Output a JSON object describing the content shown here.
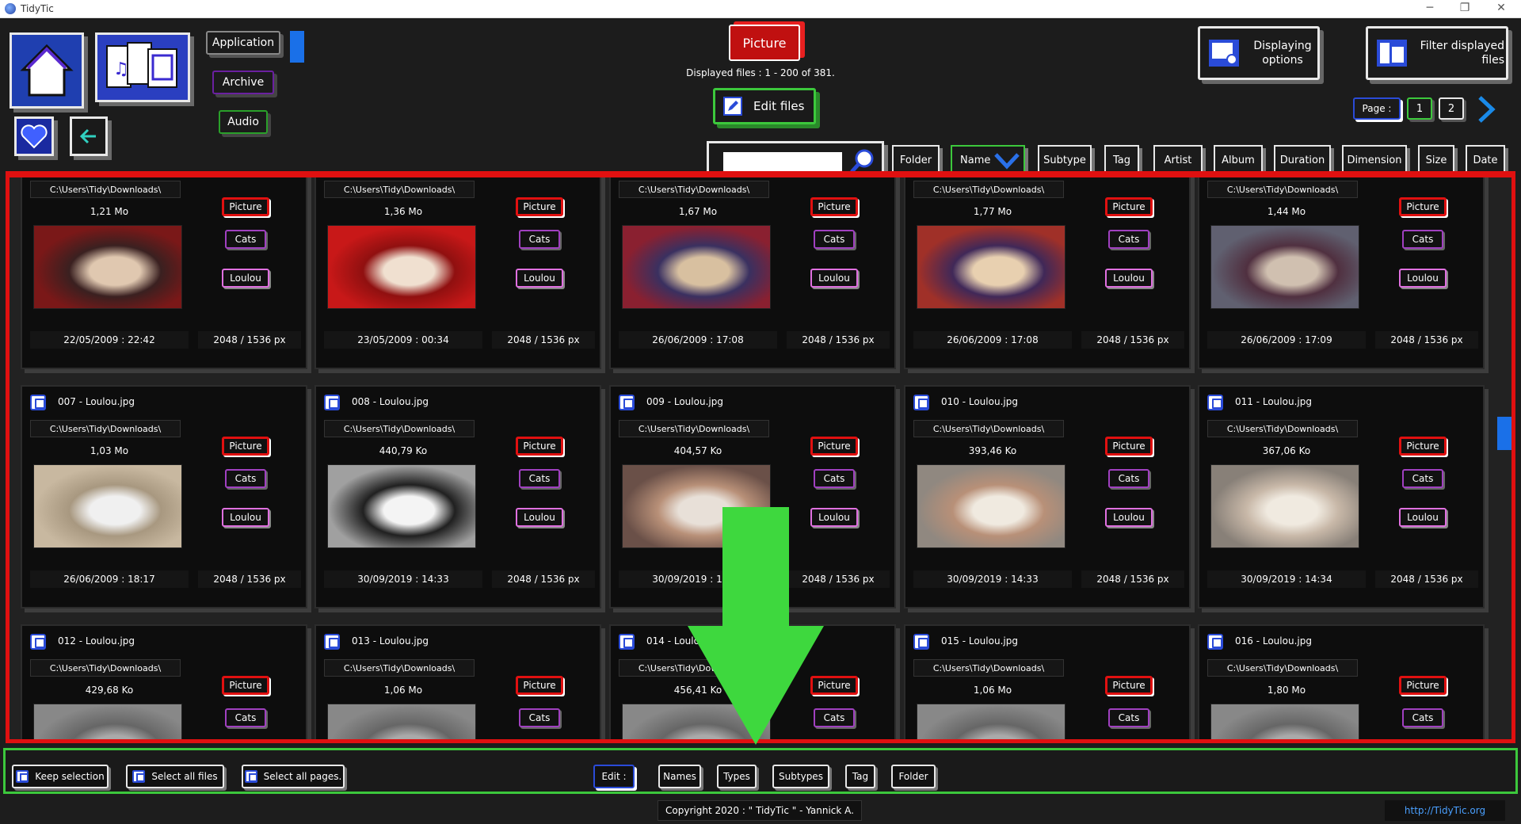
{
  "window": {
    "title": "TidyTic"
  },
  "header": {
    "category_buttons": [
      "Application",
      "Archive",
      "Audio"
    ],
    "type_badge": "Picture",
    "displayed_info": "Displayed files : 1 - 200 of 381.",
    "edit_files_label": "Edit files",
    "displaying_options_label": "Displaying options",
    "filter_label": "Filter displayed files",
    "page_label": "Page :",
    "pages": [
      "1",
      "2"
    ],
    "search_value": ""
  },
  "sort_columns": [
    "Folder",
    "Name",
    "Subtype",
    "Tag",
    "Artist",
    "Album",
    "Duration",
    "Dimension",
    "Size",
    "Date"
  ],
  "cards": [
    {
      "name": "",
      "path": "C:\\Users\\Tidy\\Downloads\\",
      "size": "1,21 Mo",
      "date": "22/05/2009 : 22:42",
      "dim": "2048 / 1536 px",
      "type": "Picture",
      "subtype": "Cats",
      "tag": "Loulou",
      "colors": [
        "#7a1818",
        "#e0c8b0",
        "#3a2020"
      ]
    },
    {
      "name": "",
      "path": "C:\\Users\\Tidy\\Downloads\\",
      "size": "1,36 Mo",
      "date": "23/05/2009 : 00:34",
      "dim": "2048 / 1536 px",
      "type": "Picture",
      "subtype": "Cats",
      "tag": "Loulou",
      "colors": [
        "#c81818",
        "#f0e0d0",
        "#901010"
      ]
    },
    {
      "name": "",
      "path": "C:\\Users\\Tidy\\Downloads\\",
      "size": "1,67 Mo",
      "date": "26/06/2009 : 17:08",
      "dim": "2048 / 1536 px",
      "type": "Picture",
      "subtype": "Cats",
      "tag": "Loulou",
      "colors": [
        "#8a2030",
        "#d8c0a0",
        "#3a3060"
      ]
    },
    {
      "name": "",
      "path": "C:\\Users\\Tidy\\Downloads\\",
      "size": "1,77 Mo",
      "date": "26/06/2009 : 17:08",
      "dim": "2048 / 1536 px",
      "type": "Picture",
      "subtype": "Cats",
      "tag": "Loulou",
      "colors": [
        "#a03028",
        "#e8d0b0",
        "#402858"
      ]
    },
    {
      "name": "",
      "path": "C:\\Users\\Tidy\\Downloads\\",
      "size": "1,44 Mo",
      "date": "26/06/2009 : 17:09",
      "dim": "2048 / 1536 px",
      "type": "Picture",
      "subtype": "Cats",
      "tag": "Loulou",
      "colors": [
        "#606070",
        "#d0c0b0",
        "#503040"
      ]
    },
    {
      "name": "007 - Loulou.jpg",
      "path": "C:\\Users\\Tidy\\Downloads\\",
      "size": "1,03 Mo",
      "date": "26/06/2009 : 18:17",
      "dim": "2048 / 1536 px",
      "type": "Picture",
      "subtype": "Cats",
      "tag": "Loulou",
      "colors": [
        "#c8b8a0",
        "#f0f0f0",
        "#a89880"
      ]
    },
    {
      "name": "008 - Loulou.jpg",
      "path": "C:\\Users\\Tidy\\Downloads\\",
      "size": "440,79 Ko",
      "date": "30/09/2019 : 14:33",
      "dim": "2048 / 1536 px",
      "type": "Picture",
      "subtype": "Cats",
      "tag": "Loulou",
      "colors": [
        "#a0a0a0",
        "#f4f4f4",
        "#202020"
      ]
    },
    {
      "name": "009 - Loulou.jpg",
      "path": "C:\\Users\\Tidy\\Downloads\\",
      "size": "404,57 Ko",
      "date": "30/09/2019 : 14:33",
      "dim": "2048 / 1536 px",
      "type": "Picture",
      "subtype": "Cats",
      "tag": "Loulou",
      "colors": [
        "#6a5048",
        "#e8e0d8",
        "#b89078"
      ]
    },
    {
      "name": "010 - Loulou.jpg",
      "path": "C:\\Users\\Tidy\\Downloads\\",
      "size": "393,46 Ko",
      "date": "30/09/2019 : 14:33",
      "dim": "2048 / 1536 px",
      "type": "Picture",
      "subtype": "Cats",
      "tag": "Loulou",
      "colors": [
        "#908880",
        "#f0eae0",
        "#b89078"
      ]
    },
    {
      "name": "011 - Loulou.jpg",
      "path": "C:\\Users\\Tidy\\Downloads\\",
      "size": "367,06 Ko",
      "date": "30/09/2019 : 14:34",
      "dim": "2048 / 1536 px",
      "type": "Picture",
      "subtype": "Cats",
      "tag": "Loulou",
      "colors": [
        "#888078",
        "#f0eae0",
        "#c8b8a8"
      ]
    },
    {
      "name": "012 - Loulou.jpg",
      "path": "C:\\Users\\Tidy\\Downloads\\",
      "size": "429,68 Ko",
      "date": "",
      "dim": "",
      "type": "Picture",
      "subtype": "Cats",
      "tag": "",
      "colors": [
        "#888",
        "#aaa",
        "#666"
      ]
    },
    {
      "name": "013 - Loulou.jpg",
      "path": "C:\\Users\\Tidy\\Downloads\\",
      "size": "1,06 Mo",
      "date": "",
      "dim": "",
      "type": "Picture",
      "subtype": "Cats",
      "tag": "",
      "colors": [
        "#888",
        "#aaa",
        "#666"
      ]
    },
    {
      "name": "014 - Loulou.jpg",
      "path": "C:\\Users\\Tidy\\Downloads\\",
      "size": "456,41 Ko",
      "date": "",
      "dim": "",
      "type": "Picture",
      "subtype": "Cats",
      "tag": "",
      "colors": [
        "#888",
        "#aaa",
        "#666"
      ]
    },
    {
      "name": "015 - Loulou.jpg",
      "path": "C:\\Users\\Tidy\\Downloads\\",
      "size": "1,06 Mo",
      "date": "",
      "dim": "",
      "type": "Picture",
      "subtype": "Cats",
      "tag": "",
      "colors": [
        "#888",
        "#aaa",
        "#666"
      ]
    },
    {
      "name": "016 - Loulou.jpg",
      "path": "C:\\Users\\Tidy\\Downloads\\",
      "size": "1,80 Mo",
      "date": "",
      "dim": "",
      "type": "Picture",
      "subtype": "Cats",
      "tag": "",
      "colors": [
        "#888",
        "#aaa",
        "#666"
      ]
    }
  ],
  "bottom": {
    "keep_selection": "Keep selection",
    "select_all_files": "Select all files",
    "select_all_pages": "Select all pages.",
    "edit_label": "Edit :",
    "edit_targets": [
      "Names",
      "Types",
      "Subtypes",
      "Tag",
      "Folder"
    ]
  },
  "footer": {
    "copyright": "Copyright 2020 : \" TidyTic \" - Yannick A.",
    "link": "http://TidyTic.org"
  },
  "colors": {
    "accent_red": "#e01010",
    "accent_green": "#3cc83c",
    "accent_blue": "#1a70e8",
    "purple": "#a040c0"
  }
}
